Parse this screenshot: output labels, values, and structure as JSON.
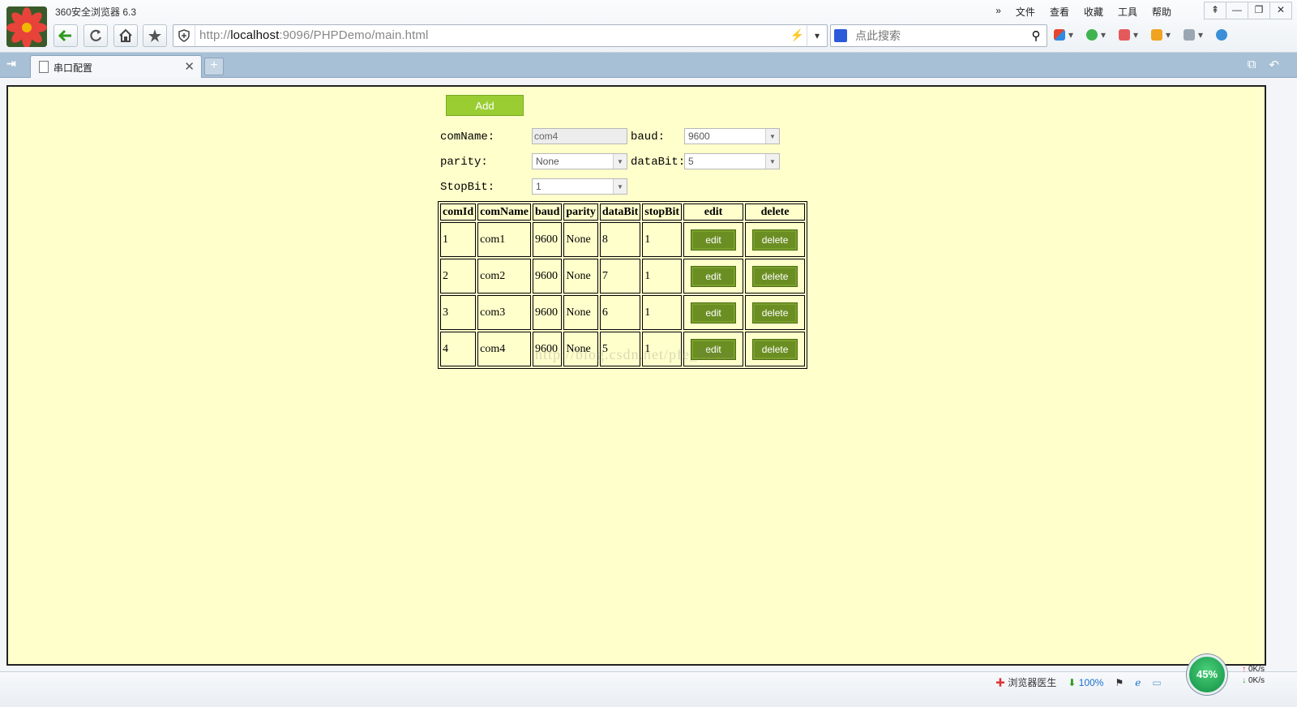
{
  "window": {
    "title": "360安全浏览器 6.3",
    "menu": [
      "»",
      "文件",
      "查看",
      "收藏",
      "工具",
      "帮助"
    ],
    "controls": [
      "⇞",
      "—",
      "❐",
      "✕"
    ]
  },
  "toolbar": {
    "url_prefix": "http://",
    "url_host": "localhost",
    "url_rest": ":9096/PHPDemo/main.html",
    "search_placeholder": "点此搜索"
  },
  "tabs": [
    {
      "title": "串口配置"
    }
  ],
  "page": {
    "add_label": "Add",
    "form": {
      "comName_label": "comName:",
      "comName_value": "com4",
      "baud_label": "baud:",
      "baud_value": "9600",
      "parity_label": "parity:",
      "parity_value": "None",
      "dataBit_label": "dataBit:",
      "dataBit_value": "5",
      "stopBit_label": "StopBit:",
      "stopBit_value": "1"
    },
    "table": {
      "headers": [
        "comId",
        "comName",
        "baud",
        "parity",
        "dataBit",
        "stopBit",
        "edit",
        "delete"
      ],
      "rows": [
        {
          "comId": "1",
          "comName": "com1",
          "baud": "9600",
          "parity": "None",
          "dataBit": "8",
          "stopBit": "1"
        },
        {
          "comId": "2",
          "comName": "com2",
          "baud": "9600",
          "parity": "None",
          "dataBit": "7",
          "stopBit": "1"
        },
        {
          "comId": "3",
          "comName": "com3",
          "baud": "9600",
          "parity": "None",
          "dataBit": "6",
          "stopBit": "1"
        },
        {
          "comId": "4",
          "comName": "com4",
          "baud": "9600",
          "parity": "None",
          "dataBit": "5",
          "stopBit": "1"
        }
      ],
      "edit_label": "edit",
      "delete_label": "delete"
    },
    "watermark": "http://blog.csdn.net/pfe_Nova"
  },
  "status": {
    "doctor": "浏览器医生",
    "zoom": "100%",
    "gauge": "45%",
    "up_speed": "0K/s",
    "down_speed": "0K/s"
  }
}
